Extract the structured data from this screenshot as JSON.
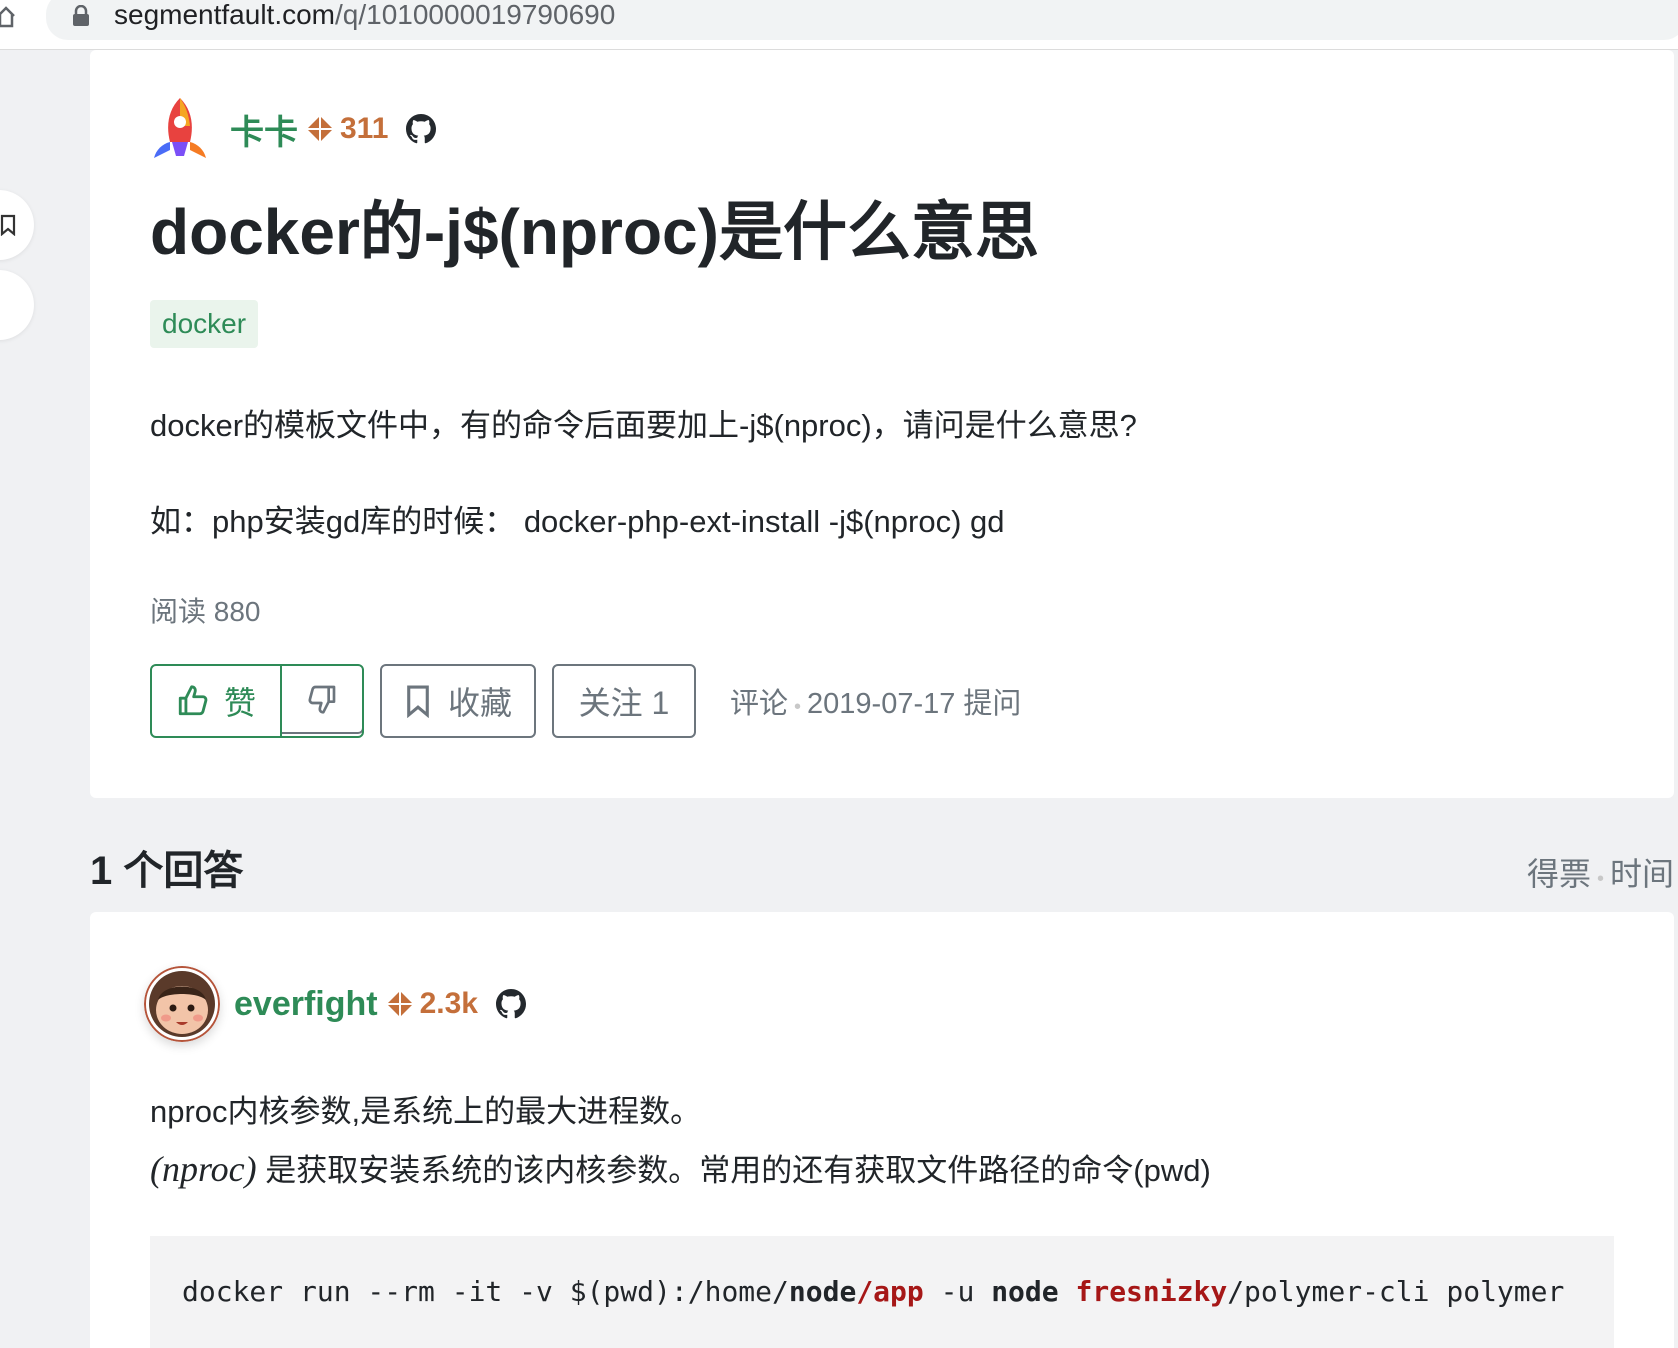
{
  "browser": {
    "url_domain": "segmentfault.com",
    "url_path": "/q/1010000019790690"
  },
  "question": {
    "author": {
      "name": "卡卡",
      "reputation": "311"
    },
    "title": "docker的-j$(nproc)是什么意思",
    "tag": "docker",
    "body_line1": "docker的模板文件中，有的命令后面要加上-j$(nproc)，请问是什么意思?",
    "body_line2": "如：php安装gd库的时候： docker-php-ext-install -j$(nproc) gd",
    "read_count": "阅读 880",
    "like_label": "赞",
    "favorite_label": "收藏",
    "follow_label": "关注 1",
    "comment_label": "评论",
    "meta_separator": "•",
    "asked_date": "2019-07-17 提问"
  },
  "answers": {
    "count_title": "1 个回答",
    "sort_votes": "得票",
    "sort_separator": "•",
    "sort_time": "时间"
  },
  "answer": {
    "author": {
      "name": "everfight",
      "reputation": "2.3k"
    },
    "body_line1": "nproc内核参数,是系统上的最大进程数。",
    "math_text": "(nproc)",
    "body_line2_rest": " 是获取安装系统的该内核参数。常用的还有获取文件路径的命令(pwd)",
    "code": {
      "part1": "docker run --rm -it -v $(pwd):/home/",
      "part2": "node",
      "part3": "/app",
      "part4": " -u ",
      "part5": "node",
      "part6": " ",
      "part7": "fresnizky",
      "part8": "/polymer-cli polymer"
    }
  },
  "colors": {
    "accent_green": "#2e8b57",
    "reputation_orange": "#c46f3a",
    "code_red": "#a61717"
  }
}
